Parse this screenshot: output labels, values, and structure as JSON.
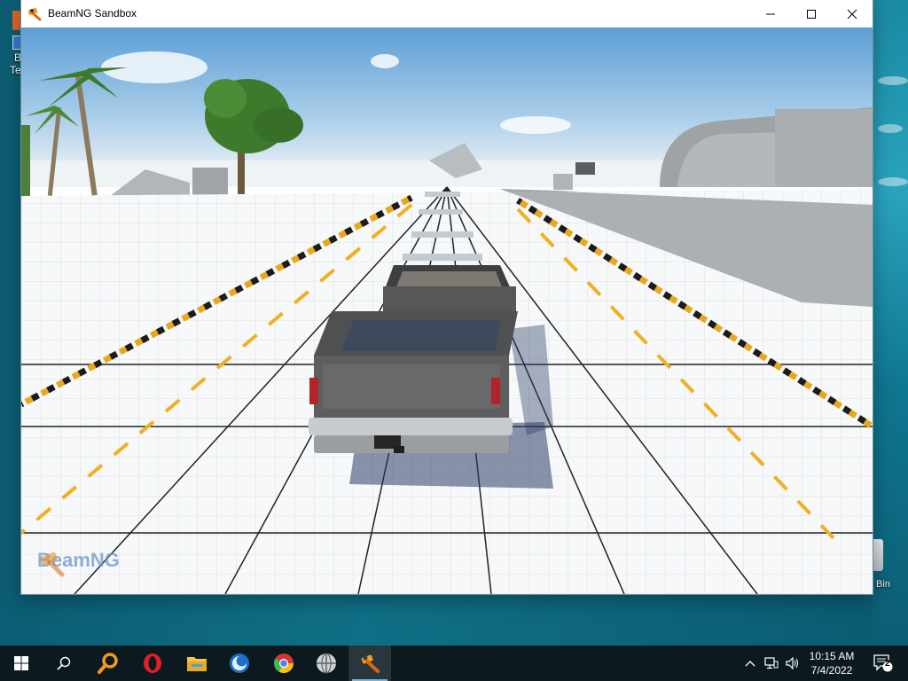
{
  "window": {
    "title": "BeamNG Sandbox"
  },
  "viewport": {
    "watermark_text": "BeamNG"
  },
  "desktop": {
    "left_icon_label_1": "B",
    "left_icon_label_2": "Te",
    "recycle_bin_label": "Bin"
  },
  "taskbar": {
    "items": [
      {
        "name": "start-button",
        "icon": "windows-logo"
      },
      {
        "name": "search-button",
        "icon": "search-icon"
      },
      {
        "name": "magnifier-app",
        "icon": "magnifier-icon"
      },
      {
        "name": "opera-app",
        "icon": "opera-icon"
      },
      {
        "name": "file-explorer-app",
        "icon": "folder-icon"
      },
      {
        "name": "blue-circle-app",
        "icon": "circle-icon"
      },
      {
        "name": "chrome-app",
        "icon": "chrome-icon"
      },
      {
        "name": "pro-app",
        "icon": "globe-icon"
      },
      {
        "name": "beamng-app",
        "icon": "beamng-icon"
      }
    ],
    "clock_time": "10:15 AM",
    "clock_date": "7/4/2022",
    "notification_count": "2"
  }
}
